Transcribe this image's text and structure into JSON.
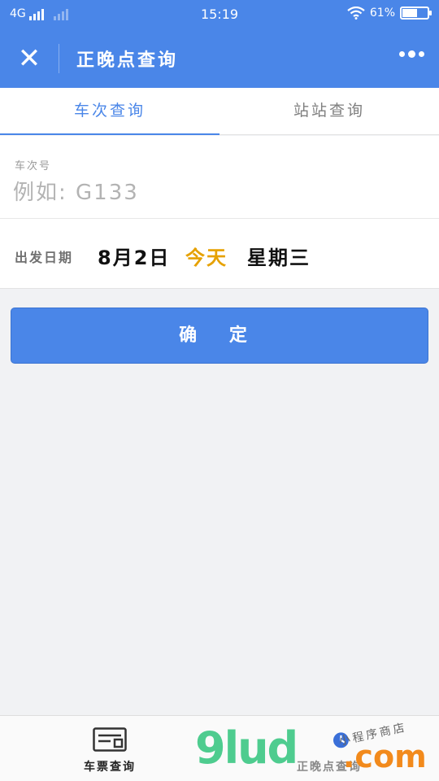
{
  "status_bar": {
    "network": "4G",
    "time": "15:19",
    "battery": "61%",
    "battery_level": 0.61
  },
  "nav": {
    "title": "正晚点查询"
  },
  "tabs": [
    {
      "label": "车次查询",
      "active": true
    },
    {
      "label": "站站查询",
      "active": false
    }
  ],
  "train_field": {
    "label": "车次号",
    "placeholder": "例如: G133",
    "value": ""
  },
  "date_field": {
    "label": "出发日期",
    "date": "8月2日",
    "today": "今天",
    "weekday": "星期三"
  },
  "confirm_label": "确 定",
  "bottom_tabs": [
    {
      "label": "车票查询",
      "icon": "ticket-icon"
    },
    {
      "label": "正晚点查询",
      "icon": "clock-icon"
    }
  ],
  "watermark": {
    "brand": "9lud",
    "suffix": ".com",
    "tagline": "小程序商店"
  },
  "colors": {
    "accent": "#4a86e8",
    "today": "#e6a100"
  }
}
